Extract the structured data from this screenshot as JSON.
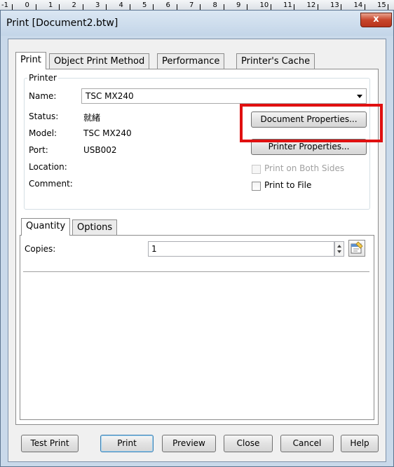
{
  "ruler": {
    "ticks": [
      "-1",
      "0",
      "1",
      "2",
      "3",
      "4",
      "5",
      "6",
      "7",
      "8",
      "9",
      "10",
      "11",
      "12",
      "13",
      "14",
      "15"
    ]
  },
  "window": {
    "title": "Print [Document2.btw]",
    "close_glyph": "x"
  },
  "tabs": [
    "Print",
    "Object Print Method",
    "Performance",
    "Printer's Cache"
  ],
  "printer": {
    "legend": "Printer",
    "name_label": "Name:",
    "name_value": "TSC MX240",
    "status_label": "Status:",
    "status_value": "就緒",
    "model_label": "Model:",
    "model_value": "TSC MX240",
    "port_label": "Port:",
    "port_value": "USB002",
    "location_label": "Location:",
    "comment_label": "Comment:",
    "document_properties": "Document Properties...",
    "printer_properties": "Printer Properties...",
    "print_both_sides": "Print on Both Sides",
    "print_to_file": "Print to File"
  },
  "subtabs": [
    "Quantity",
    "Options"
  ],
  "quantity": {
    "copies_label": "Copies:",
    "copies_value": "1"
  },
  "buttons": {
    "test_print": "Test Print",
    "print": "Print",
    "preview": "Preview",
    "close": "Close",
    "cancel": "Cancel",
    "help": "Help"
  },
  "colors": {
    "highlight": "#e01010",
    "accent": "#3c7fb1"
  }
}
